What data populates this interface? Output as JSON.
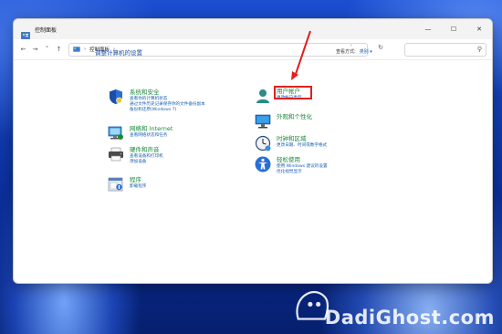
{
  "window": {
    "title": "控制面板"
  },
  "address": {
    "path_item": "控制面板"
  },
  "main": {
    "heading": "调整计算机的设置",
    "view_by_label": "查看方式:",
    "view_by_value": "类别 ▾"
  },
  "categories_left": [
    {
      "id": "system-security",
      "title": "系统和安全",
      "links": [
        "查看你的计算机状态",
        "通过文件历史记录保存你的文件备份副本",
        "备份和还原(Windows 7)"
      ]
    },
    {
      "id": "network-internet",
      "title": "网络和 Internet",
      "links": [
        "查看网络状态和任务"
      ]
    },
    {
      "id": "hardware-sound",
      "title": "硬件和声音",
      "links": [
        "查看设备和打印机",
        "添加设备"
      ]
    },
    {
      "id": "programs",
      "title": "程序",
      "links": [
        "卸载程序"
      ]
    }
  ],
  "categories_right": [
    {
      "id": "user-accounts",
      "title": "用户帐户",
      "links": [
        "更改帐户类型"
      ]
    },
    {
      "id": "appearance",
      "title": "外观和个性化",
      "links": []
    },
    {
      "id": "clock-region",
      "title": "时钟和区域",
      "links": [
        "更改日期、时间或数字格式"
      ]
    },
    {
      "id": "ease-of-access",
      "title": "轻松使用",
      "links": [
        "使用 Windows 建议的设置",
        "优化视觉显示"
      ]
    }
  ],
  "watermark": {
    "text": "DadiGhost.com"
  },
  "colors": {
    "category_title": "#1b8a3a",
    "link": "#1a5fb4",
    "highlight": "#e0201f"
  }
}
